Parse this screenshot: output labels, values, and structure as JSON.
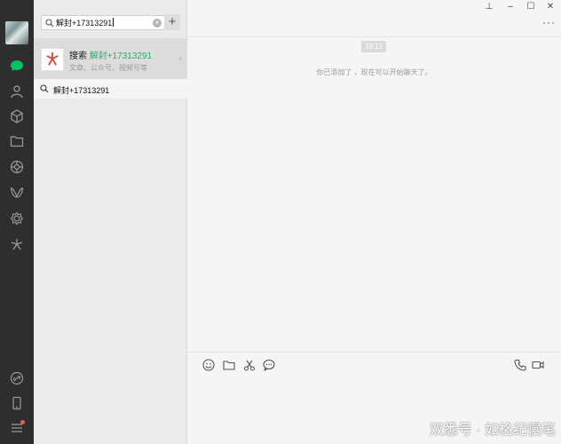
{
  "search": {
    "value": "解封+17313291",
    "clear_glyph": "×",
    "add_glyph": "+"
  },
  "result": {
    "title_prefix": "搜索",
    "title_highlight": "解封+17313291",
    "subtitle": "文章、公众号、视频号等",
    "arrow": "›"
  },
  "query": {
    "text": "解封+17313291"
  },
  "window": {
    "pin": "⊥",
    "minimize": "–",
    "maximize": "☐",
    "close": "✕",
    "more": "···"
  },
  "chat": {
    "timestamp": "19:12",
    "system_message": "你已添加了 ，现在可以开始聊天了。"
  },
  "watermark": "双悉号 · 如格纪慢笔",
  "colors": {
    "sidebar": "#2e2e2e",
    "accent": "#07c160",
    "highlight": "#2aae67",
    "badge": "#fa5151"
  },
  "icons": {
    "sidebar": [
      "chat-icon",
      "contacts-icon",
      "favorites-icon",
      "files-icon",
      "moments-icon",
      "channels-icon",
      "mini-programs-icon",
      "discover-icon",
      "link-icon",
      "phone-icon",
      "menu-icon"
    ],
    "toolbar": [
      "emoji-icon",
      "folder-icon",
      "scissors-icon",
      "speech-icon",
      "voice-call-icon",
      "video-call-icon"
    ]
  }
}
